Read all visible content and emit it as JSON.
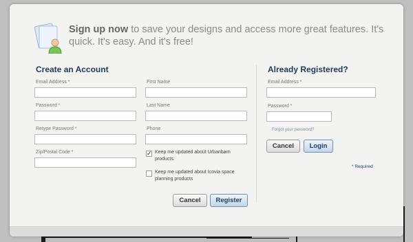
{
  "header": {
    "headline_bold": "Sign up now",
    "headline_rest": " to save your designs and access more great features.  It's quick.  It's easy.  And it's free!"
  },
  "create": {
    "title": "Create an Account",
    "email_label": "Email Address *",
    "password_label": "Password *",
    "retype_label": "Retype Password *",
    "zip_label": "Zip/Postal Code *",
    "first_label": "First Name",
    "last_label": "Last Name",
    "phone_label": "Phone",
    "check1_label": "Keep me updated about Urbanbarn products.",
    "check1_checked": true,
    "check2_label": "Keep me updated about Icovia space planning products",
    "check2_checked": false,
    "cancel": "Cancel",
    "register": "Register"
  },
  "login": {
    "title": "Already Registered?",
    "email_label": "Email Address *",
    "password_label": "Password *",
    "forgot": "Forgot your password?",
    "cancel": "Cancel",
    "login": "Login",
    "required": "* Required"
  },
  "icons": {
    "user": "user-document-icon",
    "checkmark": "checkmark-icon"
  },
  "colors": {
    "heading": "#1f3a5a",
    "primary_button": "#c3d6ea"
  }
}
